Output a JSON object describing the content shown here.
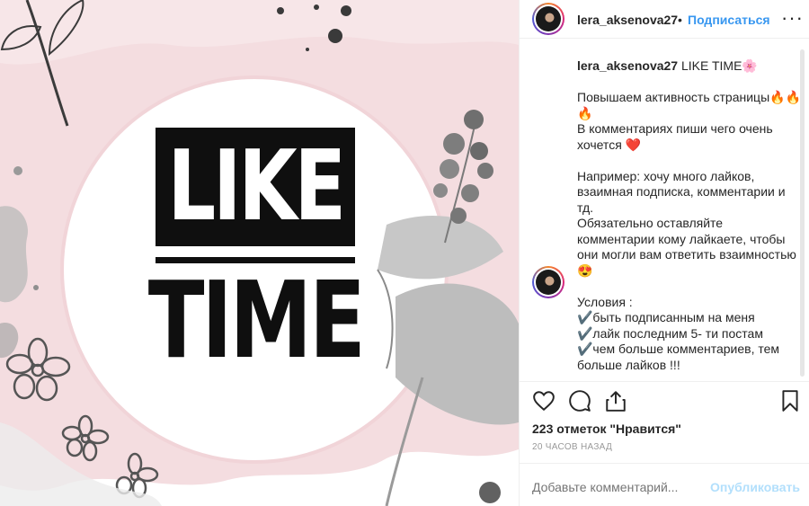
{
  "image": {
    "word_top": "LIKE",
    "word_bottom": "TIME"
  },
  "header": {
    "username": "lera_aksenova27",
    "separator": "•",
    "follow_label": "Подписаться",
    "more_icon": "more-horizontal-icon"
  },
  "caption": {
    "username": "lera_aksenova27",
    "lines": [
      "LIKE TIME🌸",
      "",
      "Повышаем активность страницы🔥🔥🔥",
      "В комментариях пиши чего очень хочется ❤️",
      "",
      "Например: хочу много лайков, взаимная подписка, комментарии и тд.",
      "Обязательно оставляйте комментарии кому лайкаете, чтобы они могли вам ответить взаимностью 😍",
      "",
      "Условия :",
      "✔️быть подписанным на меня",
      "✔️лайк последним 5- ти постам",
      "✔️чем больше комментариев, тем больше лайков !!!"
    ]
  },
  "actions": {
    "like_icon": "heart-icon",
    "comment_icon": "comment-icon",
    "share_icon": "share-icon",
    "save_icon": "bookmark-icon",
    "likes_text": "223 отметок \"Нравится\"",
    "time_ago": "20 ЧАСОВ НАЗАД"
  },
  "comment": {
    "placeholder": "Добавьте комментарий...",
    "publish_label": "Опубликовать"
  },
  "colors": {
    "accent": "#3897f0",
    "publish_disabled": "#b2dffc",
    "pink_bg": "#f3dadd"
  }
}
